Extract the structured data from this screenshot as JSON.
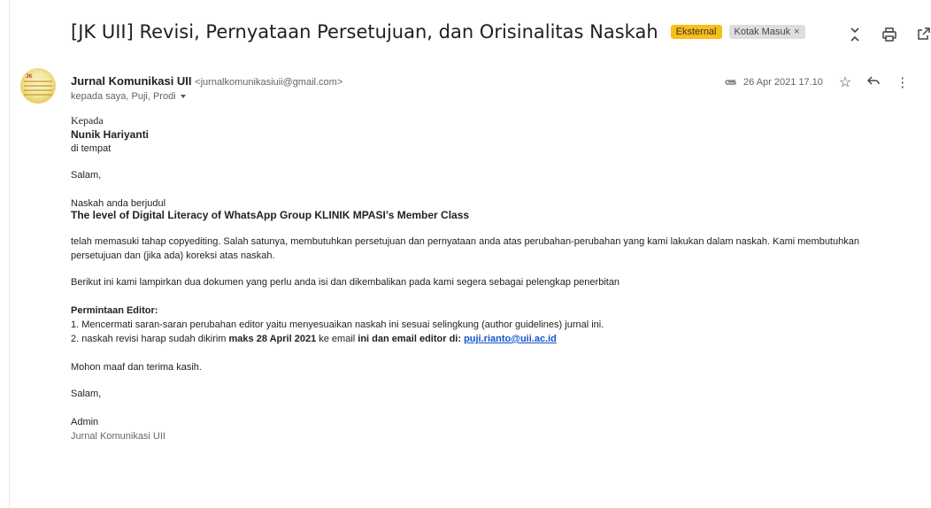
{
  "subject": "[JK UII] Revisi, Pernyataan Persetujuan, dan Orisinalitas Naskah",
  "labels": {
    "external": "Eksternal",
    "inbox": "Kotak Masuk",
    "inbox_close": "×"
  },
  "sender": {
    "name": "Jurnal Komunikasi UII",
    "email": "<jurnalkomunikasiuii@gmail.com>"
  },
  "recipients": "kepada saya, Puji, Prodi",
  "date": "26 Apr 2021 17.10",
  "icons": {
    "collapse": "unfold-less-icon",
    "print": "print-icon",
    "open_new": "open-in-new-icon",
    "attachment": "paperclip-icon",
    "star": "star-icon",
    "reply": "reply-icon",
    "more": "more-vert-icon",
    "dropdown": "caret-down-icon"
  },
  "body": {
    "greeting_to": "Kepada",
    "recipient_name": "Nunik Hariyanti",
    "at_place": "di tempat",
    "salam1": "Salam,",
    "naskah_label": "Naskah anda berjudul",
    "paper_title": "The level of Digital Literacy of WhatsApp Group KLINIK MPASI’s Member Class",
    "para1": "telah memasuki tahap copyediting. Salah satunya, membutuhkan persetujuan dan pernyataan anda atas perubahan-perubahan yang kami lakukan dalam naskah. Kami membutuhkan persetujuan dan (jika ada) koreksi atas naskah.",
    "para2": "Berikut ini kami lampirkan dua dokumen yang perlu anda isi dan dikembalikan pada kami segera sebagai pelengkap penerbitan",
    "editor_heading": "Permintaan Editor:",
    "req1": "1. Mencermati saran-saran perubahan editor yaitu menyesuaikan naskah ini sesuai selingkung (author guidelines) jurnal ini.",
    "req2_start": "2. naskah revisi harap sudah dikirim ",
    "req2_deadline": "maks 28 April 2021",
    "req2_mid": " ke email ",
    "req2_bold": "ini dan email editor di: ",
    "req2_link": "puji.rianto@uii.ac.id",
    "apology": "Mohon maaf dan terima kasih.",
    "salam2": "Salam,",
    "sign_role": "Admin",
    "sign_org": "Jurnal Komunikasi UII"
  }
}
